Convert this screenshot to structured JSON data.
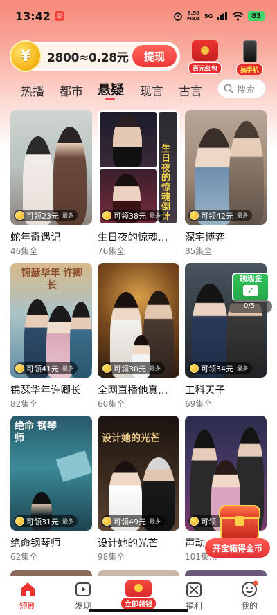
{
  "status_bar": {
    "time": "13:42",
    "network_speed_top": "6.50",
    "network_speed_unit": "MB/s",
    "signal": "5G",
    "battery": "83"
  },
  "coin_bar": {
    "coin_symbol": "¥",
    "balance_text": "2800≈0.28元",
    "withdraw_label": "提现"
  },
  "promos": [
    {
      "label": "百元红包",
      "icon": "red-packet-icon"
    },
    {
      "label": "抽手机",
      "icon": "phone-icon"
    }
  ],
  "tabs": [
    {
      "label": "热播",
      "active": false
    },
    {
      "label": "都市",
      "active": false
    },
    {
      "label": "悬疑",
      "active": true
    },
    {
      "label": "现言",
      "active": false
    },
    {
      "label": "古言",
      "active": false
    }
  ],
  "search": {
    "placeholder": "搜索"
  },
  "dramas": [
    {
      "title": "蛇年奇遇记",
      "episodes": "46集全",
      "reward": "可领23元",
      "more": "最多",
      "art": ""
    },
    {
      "title": "生日夜的惊魂…",
      "episodes": "76集全",
      "reward": "可领38元",
      "more": "最多",
      "art": "生日夜的惊魂倒计"
    },
    {
      "title": "深宅博弈",
      "episodes": "85集全",
      "reward": "可领42元",
      "more": "最多",
      "art": ""
    },
    {
      "title": "锦瑟华年许卿长",
      "episodes": "82集全",
      "reward": "可领41元",
      "more": "最多",
      "art": "锦瑟华年 许卿长"
    },
    {
      "title": "全网直播他真…",
      "episodes": "60集全",
      "reward": "可领30元",
      "more": "最多",
      "art": ""
    },
    {
      "title": "工科天子",
      "episodes": "69集全",
      "reward": "可领34元",
      "more": "最多",
      "art": ""
    },
    {
      "title": "绝命钢琴师",
      "episodes": "62集全",
      "reward": "可领31元",
      "more": "最多",
      "art": "绝命 钢琴师"
    },
    {
      "title": "设计她的光芒",
      "episodes": "98集全",
      "reward": "可领49元",
      "more": "最多",
      "art": "设计她的光芒"
    },
    {
      "title": "声动…",
      "episodes": "101集…",
      "reward": "可领…",
      "more": "最多",
      "art": ""
    }
  ],
  "cash_widget": {
    "label": "领现金",
    "progress": "0/5"
  },
  "chest": {
    "button_label": "开宝箱得金币"
  },
  "bottom_nav": [
    {
      "label": "短剧",
      "icon": "home-icon",
      "active": true
    },
    {
      "label": "发现",
      "icon": "play-icon",
      "active": false
    },
    {
      "label": "立即领钱",
      "icon": "red-envelope-icon",
      "active": false
    },
    {
      "label": "福利",
      "icon": "gift-icon",
      "active": false
    },
    {
      "label": "我的",
      "icon": "profile-icon",
      "active": false
    }
  ],
  "colors": {
    "accent": "#e8322f",
    "header_gradient_top": "#f58a7a",
    "coin_gold": "#f8b81e"
  }
}
